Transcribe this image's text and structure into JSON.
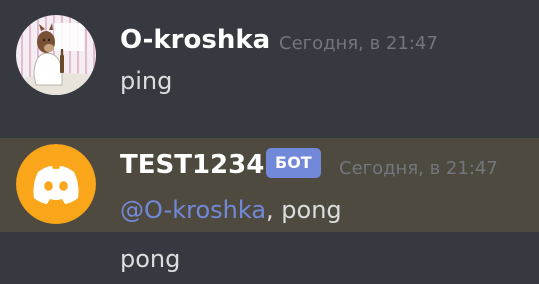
{
  "messages": [
    {
      "author": "O-kroshka",
      "timestamp": "Сегодня, в 21:47",
      "text": "ping",
      "avatar_icon": "cartoon-horse-avatar-icon"
    },
    {
      "author": "TEST1234",
      "bot_tag": "БОТ",
      "timestamp": "Сегодня, в 21:47",
      "mention": "@O-kroshka",
      "text": ", pong",
      "avatar_icon": "discord-logo-icon",
      "highlight_color": "#4f4a3f"
    },
    {
      "text": "pong"
    }
  ],
  "colors": {
    "background": "#36393f",
    "mention": "#7289da",
    "bot_tag": "#7289da",
    "discord_avatar": "#faa61a"
  }
}
